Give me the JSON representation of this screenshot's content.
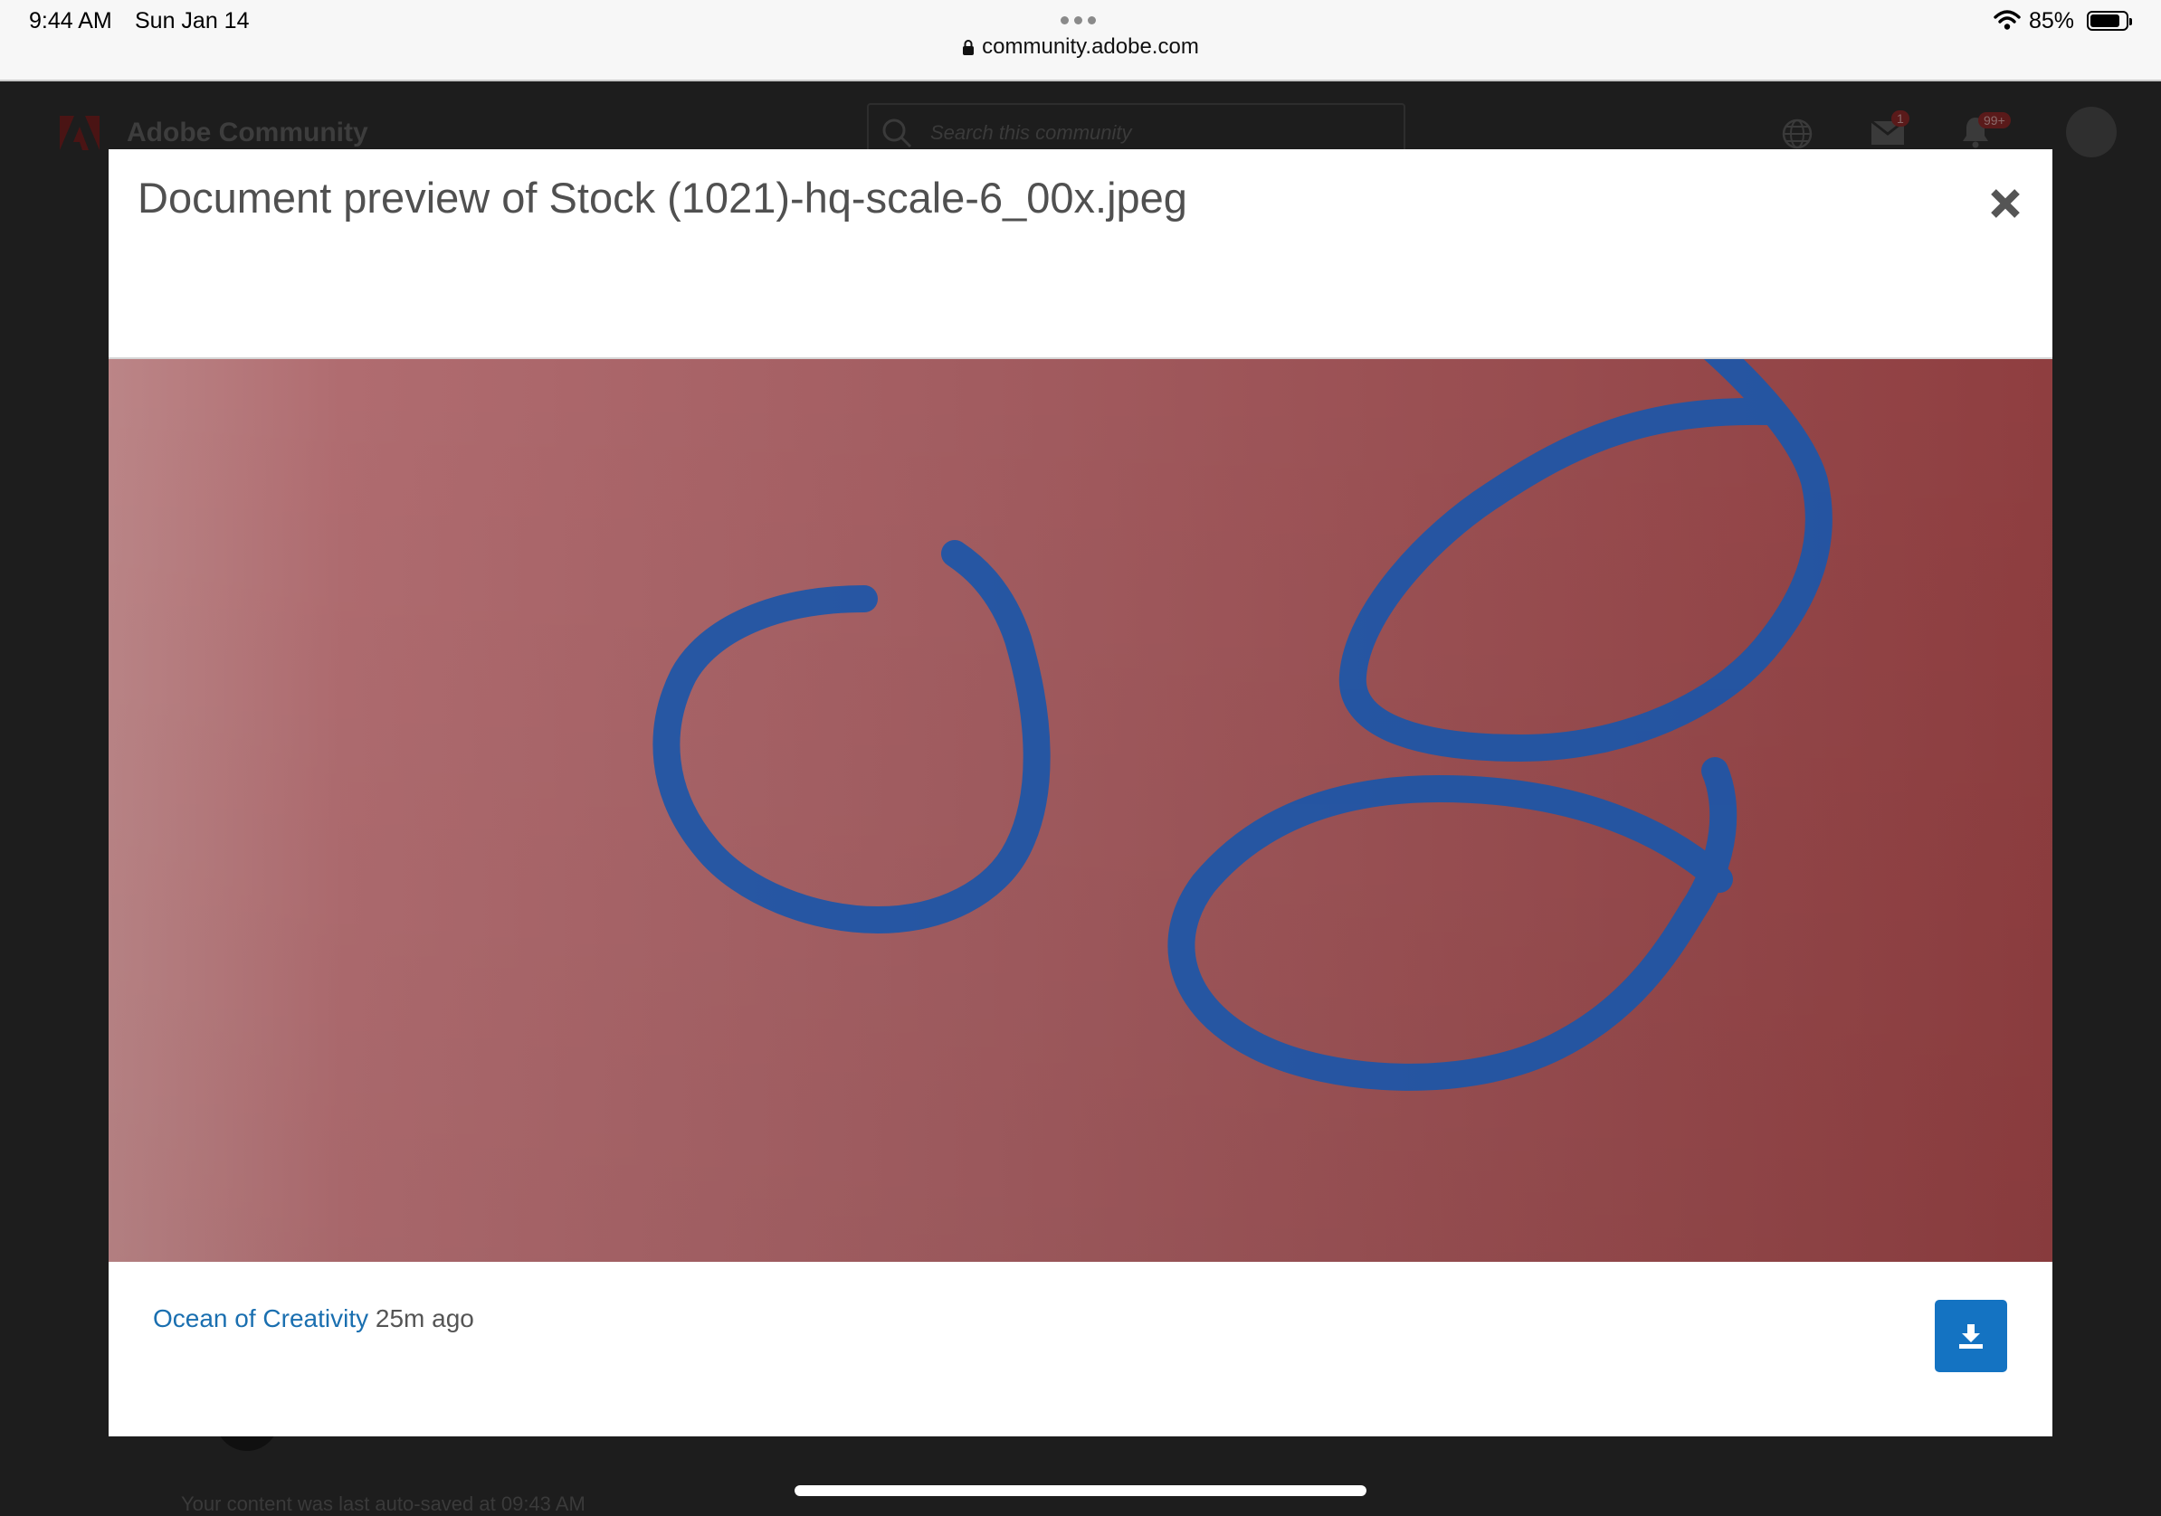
{
  "status_bar": {
    "time": "9:44 AM",
    "date": "Sun Jan 14",
    "battery_percent": "85%",
    "battery_level": 0.85,
    "icons": [
      "wifi-icon",
      "battery-icon"
    ]
  },
  "browser": {
    "url": "community.adobe.com",
    "icons": [
      "lock-icon",
      "more-dots-icon"
    ]
  },
  "background_page": {
    "site_title": "Adobe Community",
    "search_placeholder": "Search this community",
    "message_badge": "1",
    "notification_badge": "99+",
    "footer_text": "Your content was last auto-saved at 09:43 AM",
    "icons": [
      "adobe-logo-icon",
      "search-icon",
      "globe-icon",
      "messages-icon",
      "notifications-bell-icon",
      "avatar"
    ]
  },
  "modal": {
    "title": "Document preview of Stock (1021)-hq-scale-6_00x.jpeg",
    "author": "Ocean of Creativity",
    "time_ago": "25m ago",
    "icons": [
      "close-icon",
      "download-icon"
    ],
    "colors": {
      "preview_background": "#a85a5c",
      "ink": "#1d56a8",
      "author_link": "#1a6fb0",
      "download_button": "#1473c2"
    }
  }
}
